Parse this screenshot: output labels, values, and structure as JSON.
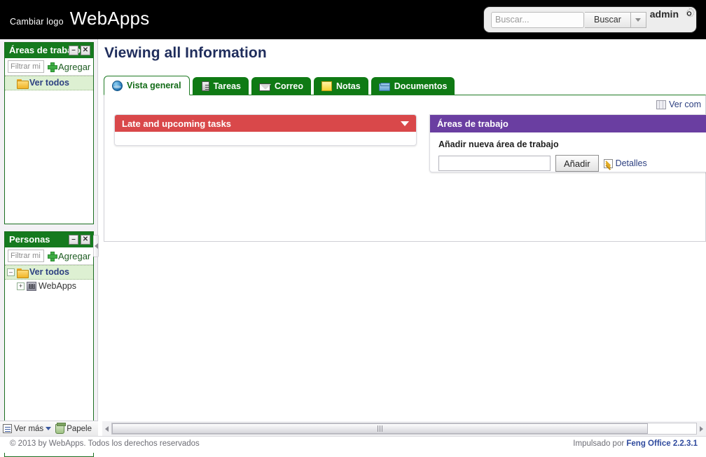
{
  "topbar": {
    "change_logo": "Cambiar logo",
    "app_title": "WebApps",
    "search": {
      "placeholder": "Buscar...",
      "value": "",
      "button_label": "Buscar",
      "dropdown_icon": "chevron-down-icon"
    },
    "user": {
      "name": "admin",
      "settings_icon": "gear-icon"
    }
  },
  "sidebar": {
    "panels": [
      {
        "title": "Áreas de trabajo",
        "minimize_label": "–",
        "close_label": "✕",
        "filter_placeholder": "Filtrar mi",
        "filter_value": "",
        "add_label": "Agregar",
        "add_icon": "plus-icon",
        "tree": [
          {
            "label": "Ver todos",
            "icon": "folder-icon",
            "selected": true,
            "expander": "",
            "indent": 0
          }
        ]
      },
      {
        "title": "Personas",
        "minimize_label": "–",
        "close_label": "✕",
        "filter_placeholder": "Filtrar mi",
        "filter_value": "",
        "add_label": "Agregar",
        "add_icon": "plus-icon",
        "tree": [
          {
            "label": "Ver todos",
            "icon": "folder-icon",
            "selected": true,
            "expander": "–",
            "indent": 0
          },
          {
            "label": "WebApps",
            "icon": "building-icon",
            "selected": false,
            "expander": "+",
            "indent": 1
          }
        ]
      }
    ],
    "footer": {
      "more_label": "Ver más",
      "more_icon": "list-icon",
      "more_caret": "chevron-down-icon",
      "trash_label": "Papele",
      "trash_icon": "trash-icon"
    }
  },
  "main": {
    "page_title": "Viewing all Information",
    "tabs": [
      {
        "label": "Vista general",
        "icon": "globe-icon",
        "active": true
      },
      {
        "label": "Tareas",
        "icon": "task-icon",
        "active": false
      },
      {
        "label": "Correo",
        "icon": "mail-icon",
        "active": false
      },
      {
        "label": "Notas",
        "icon": "note-icon",
        "active": false
      },
      {
        "label": "Documentos",
        "icon": "document-icon",
        "active": false
      }
    ],
    "view_columns": {
      "label": "Ver com",
      "icon": "columns-icon"
    },
    "widgets": {
      "tasks": {
        "title": "Late and upcoming tasks",
        "collapse_icon": "caret-down-icon",
        "body": ""
      },
      "workspaces": {
        "title": "Áreas de trabajo",
        "add_label": "Añadir nueva área de trabajo",
        "input_value": "",
        "add_button": "Añadir",
        "details_label": "Detalles",
        "details_icon": "pencil-icon"
      }
    },
    "scrollbar": {
      "left_icon": "arrow-left-icon",
      "right_icon": "arrow-right-icon",
      "grip_icon": "grip-icon"
    }
  },
  "footer": {
    "copyright": "© 2013 by WebApps. Todos los derechos reservados",
    "powered_prefix": "Impulsado por ",
    "powered_brand": "Feng Office 2.2.3.1"
  },
  "colors": {
    "topbar_bg": "#000000",
    "panel_green": "#157a1e",
    "tab_green": "#0f7a14",
    "widget_red": "#d9484a",
    "widget_purple": "#6a3ea1",
    "link_blue": "#2c3f80",
    "title_navy": "#1f2d5c"
  }
}
